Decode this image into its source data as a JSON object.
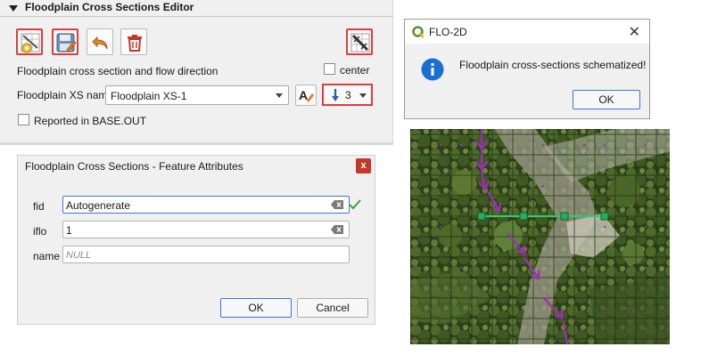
{
  "editor": {
    "title": "Floodplain Cross Sections Editor",
    "xs_flow_label": "Floodplain cross section and flow direction",
    "center_label": "center",
    "xs_name_label": "Floodplain XS name",
    "xs_name_value": "Floodplain XS-1",
    "flow_direction_value": "3",
    "reported_label": "Reported in BASE.OUT"
  },
  "attributes_dialog": {
    "title": "Floodplain Cross Sections - Feature Attributes",
    "close_label": "x",
    "fields": {
      "fid": {
        "label": "fid",
        "value": "Autogenerate"
      },
      "iflo": {
        "label": "iflo",
        "value": "1"
      },
      "name": {
        "label": "name",
        "placeholder": "NULL"
      }
    },
    "ok_label": "OK",
    "cancel_label": "Cancel"
  },
  "message_box": {
    "title": "FLO-2D",
    "message": "Floodplain cross-sections schematized!",
    "ok_label": "OK",
    "close_label": "✕"
  },
  "colors": {
    "highlight": "#e23a3a",
    "focus_blue": "#3b78d8",
    "flow_arrow": "#9a2fb0",
    "cross_section_line": "#2ecc71",
    "info_icon": "#1a6fd1",
    "qgis_green": "#589632"
  },
  "icons": {
    "add_xs": "add-cross-section-icon",
    "save": "save-edits-icon",
    "undo": "undo-icon",
    "delete": "delete-icon",
    "schematize": "schematize-icon",
    "rename": "rename-icon",
    "flow_direction": "down-arrow-icon",
    "info": "info-icon",
    "accept": "checkmark-icon"
  }
}
